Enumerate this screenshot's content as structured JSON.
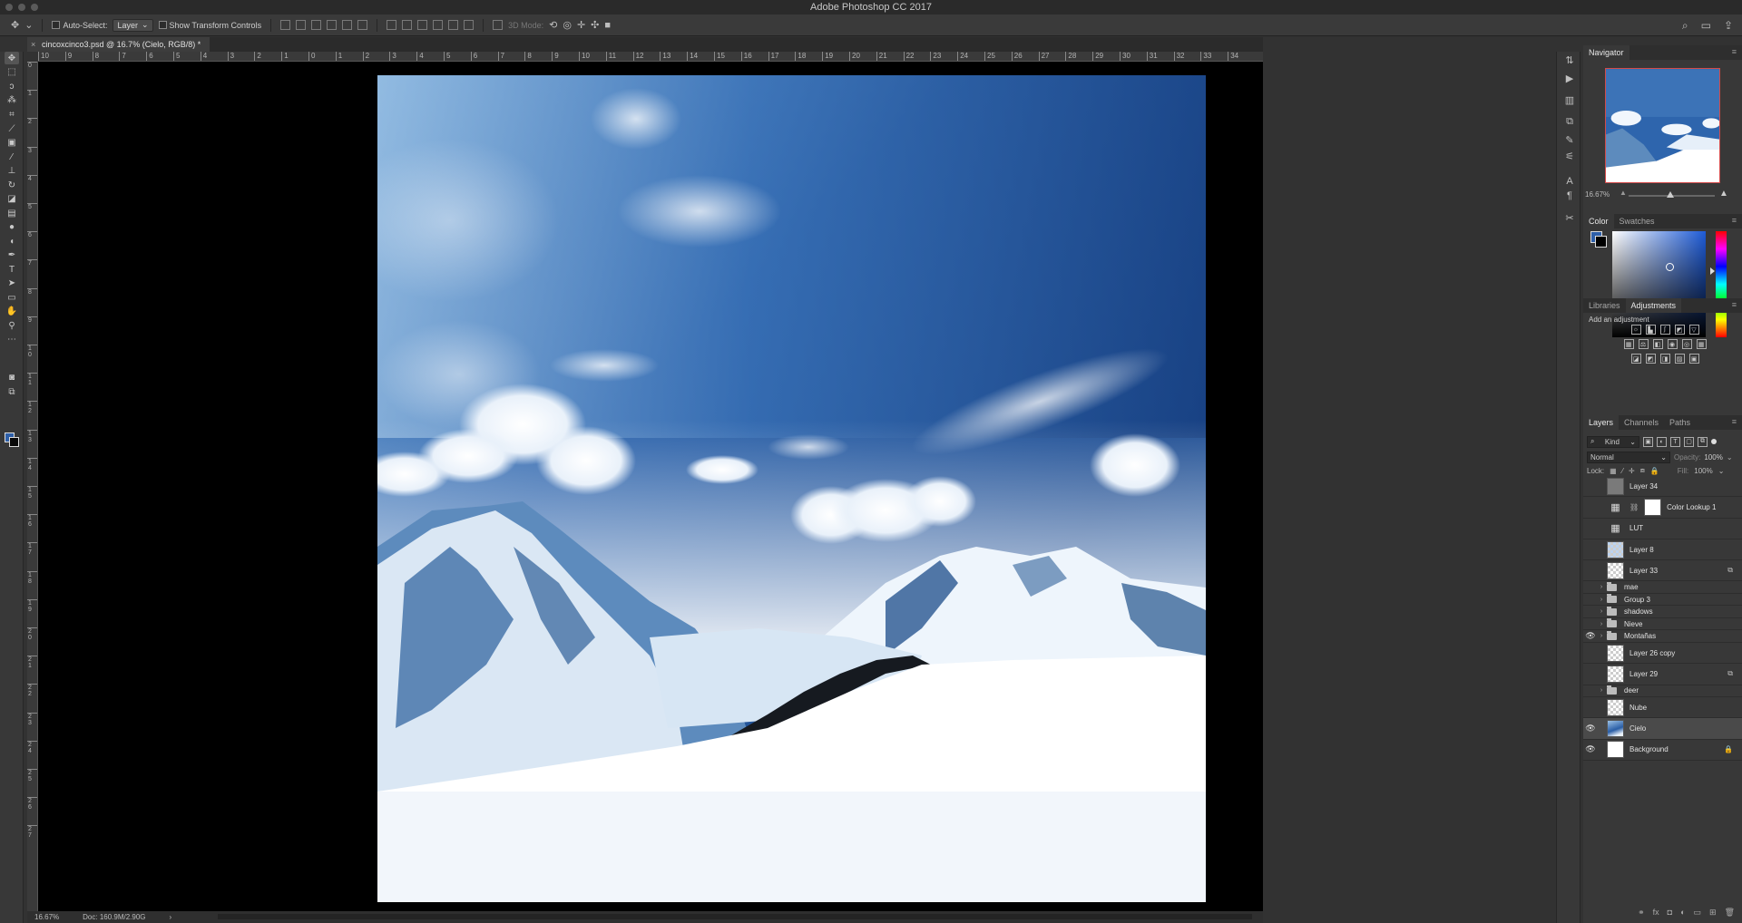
{
  "window": {
    "title": "Adobe Photoshop CC 2017"
  },
  "options_bar": {
    "auto_select_label": "Auto-Select:",
    "auto_select_value": "Layer",
    "show_transform_label": "Show Transform Controls",
    "mode_3d_label": "3D Mode:"
  },
  "document": {
    "tab_title": "cincoxcinco3.psd @ 16.7% (Cielo, RGB/8) *",
    "close_glyph": "×"
  },
  "ruler_h": [
    "10",
    "9",
    "8",
    "7",
    "6",
    "5",
    "4",
    "3",
    "2",
    "1",
    "0",
    "1",
    "2",
    "3",
    "4",
    "5",
    "6",
    "7",
    "8",
    "9",
    "10",
    "11",
    "12",
    "13",
    "14",
    "15",
    "16",
    "17",
    "18",
    "19",
    "20",
    "21",
    "22",
    "23",
    "24",
    "25",
    "26",
    "27",
    "28",
    "29",
    "30",
    "31",
    "32",
    "33",
    "34"
  ],
  "ruler_v": [
    "0",
    "1",
    "2",
    "3",
    "4",
    "5",
    "6",
    "7",
    "8",
    "9",
    "1\n0",
    "1\n1",
    "1\n2",
    "1\n3",
    "1\n4",
    "1\n5",
    "1\n6",
    "1\n7",
    "1\n8",
    "1\n9",
    "2\n0",
    "2\n1",
    "2\n2",
    "2\n3",
    "2\n4",
    "2\n5",
    "2\n6",
    "2\n7"
  ],
  "status": {
    "zoom": "16.67%",
    "doc_info": "Doc: 160.9M/2.90G"
  },
  "navigator": {
    "tab": "Navigator",
    "zoom": "16.67%"
  },
  "color_panel": {
    "tabs": [
      "Color",
      "Swatches"
    ]
  },
  "adjustments": {
    "tabs": [
      "Libraries",
      "Adjustments"
    ],
    "label": "Add an adjustment"
  },
  "layers_panel": {
    "tabs": [
      "Layers",
      "Channels",
      "Paths"
    ],
    "filter_kind": "Kind",
    "blend_mode": "Normal",
    "opacity_label": "Opacity:",
    "opacity_value": "100%",
    "lock_label": "Lock:",
    "fill_label": "Fill:",
    "fill_value": "100%",
    "layers": [
      {
        "name": "Layer 34",
        "kind": "gray",
        "visible": false
      },
      {
        "name": "Color Lookup 1",
        "kind": "adjustment",
        "visible": false
      },
      {
        "name": "LUT",
        "kind": "grid",
        "visible": false
      },
      {
        "name": "Layer 8",
        "kind": "blue-checker",
        "visible": false
      },
      {
        "name": "Layer 33",
        "kind": "checker",
        "visible": false,
        "right_icon": "smart-object-icon"
      },
      {
        "name": "mae",
        "kind": "group",
        "visible": false
      },
      {
        "name": "Group 3",
        "kind": "group",
        "visible": false
      },
      {
        "name": "shadows",
        "kind": "group",
        "visible": false
      },
      {
        "name": "Nieve",
        "kind": "group",
        "visible": false
      },
      {
        "name": "Montañas",
        "kind": "group",
        "visible": true
      },
      {
        "name": "Layer 26 copy",
        "kind": "checker",
        "visible": false
      },
      {
        "name": "Layer 29",
        "kind": "checker",
        "visible": false,
        "right_icon": "smart-object-icon"
      },
      {
        "name": "deer",
        "kind": "group",
        "visible": false
      },
      {
        "name": "Nube",
        "kind": "checker",
        "visible": false
      },
      {
        "name": "Cielo",
        "kind": "sky",
        "visible": true,
        "selected": true
      },
      {
        "name": "Background",
        "kind": "white",
        "visible": true,
        "right_icon": "lock-icon"
      }
    ]
  },
  "colors": {
    "foreground": "#2e5fa8",
    "background": "#000000",
    "accent_red": "#d34a4a"
  },
  "glyphs": {
    "eye": "👁",
    "caret": "›",
    "lock": "🔒",
    "smart": "⧉",
    "search": "⌕",
    "panel_menu": "≡",
    "chevron": "⌄",
    "footer": [
      "⚭",
      "fx",
      "◘",
      "◐",
      "▭",
      "⊞",
      "🗑"
    ]
  }
}
